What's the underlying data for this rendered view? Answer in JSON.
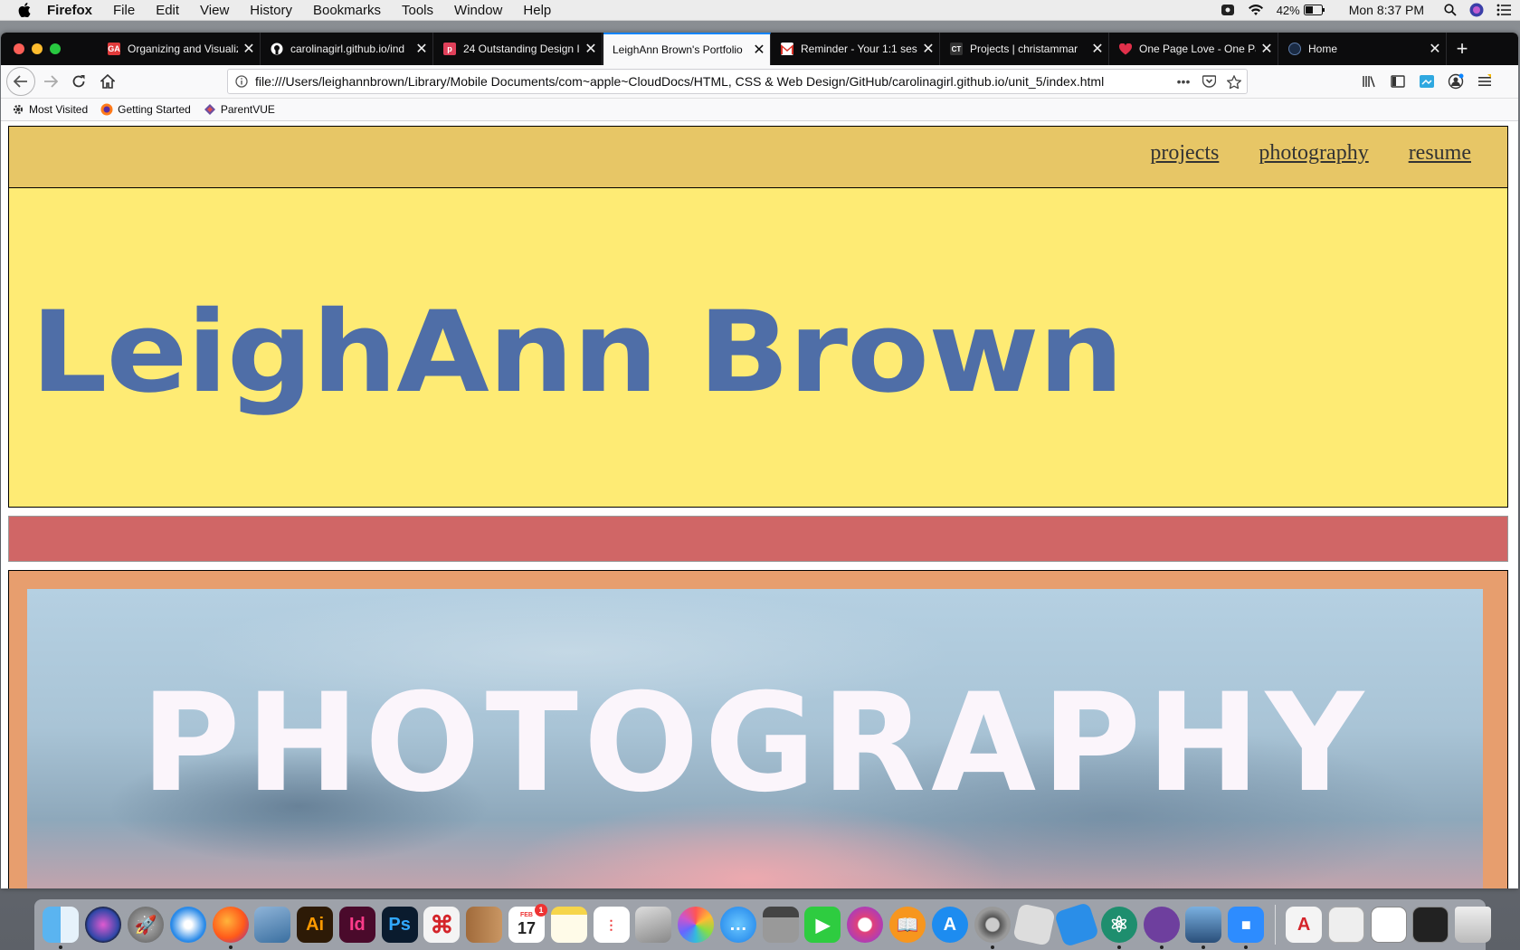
{
  "menubar": {
    "app_name": "Firefox",
    "menus": [
      "File",
      "Edit",
      "View",
      "History",
      "Bookmarks",
      "Tools",
      "Window",
      "Help"
    ],
    "battery": "42%",
    "clock": "Mon 8:37 PM"
  },
  "browser": {
    "tabs": [
      {
        "title": "Organizing and Visualiz",
        "favicon": "GA",
        "color": "#e03b3b"
      },
      {
        "title": "carolinagirl.github.io/ind",
        "favicon": "github-icon",
        "color": "#ffffff"
      },
      {
        "title": "24 Outstanding Design I",
        "favicon": "p",
        "color": "#e0405a"
      },
      {
        "title": "LeighAnn Brown's Portfolio",
        "favicon": "",
        "color": "",
        "active": true
      },
      {
        "title": "Reminder - Your 1:1 ses",
        "favicon": "gmail-icon",
        "color": "#d93025"
      },
      {
        "title": "Projects | christammar",
        "favicon": "CT",
        "color": "#333333"
      },
      {
        "title": "One Page Love - One Pa",
        "favicon": "heart-icon",
        "color": "#e0304a"
      },
      {
        "title": "Home",
        "favicon": "circle-icon",
        "color": "#1a2b44"
      }
    ],
    "url": "file:///Users/leighannbrown/Library/Mobile Documents/com~apple~CloudDocs/HTML, CSS & Web Design/GitHub/carolinagirl.github.io/unit_5/index.html",
    "bookmarks": [
      "Most Visited",
      "Getting Started",
      "ParentVUE"
    ]
  },
  "page": {
    "nav": [
      "projects",
      "photography",
      "resume"
    ],
    "name": "LeighAnn Brown",
    "photo_heading": "PHOTOGRAPHY",
    "colors": {
      "header": "#e7c666",
      "hero": "#feeb74",
      "name": "#4f6ea7",
      "stripe": "#d06666",
      "frame": "#e79e6e"
    }
  },
  "dock": {
    "apps": [
      "Finder",
      "Siri",
      "Launchpad",
      "Safari",
      "Firefox",
      "Preview",
      "Illustrator",
      "InDesign",
      "Photoshop",
      "Acrobat",
      "Contacts",
      "Calendar",
      "Notes",
      "Reminders",
      "Photo Booth",
      "Photos",
      "Messages",
      "Calculator",
      "FaceTime",
      "iTunes",
      "iBooks",
      "App Store",
      "System Preferences",
      "Roblox",
      "Xcode",
      "Atom",
      "GitHub Desktop",
      "Image Capture",
      "Zoom"
    ],
    "calendar_month": "FEB",
    "calendar_day": "17",
    "calendar_badge": "1"
  }
}
